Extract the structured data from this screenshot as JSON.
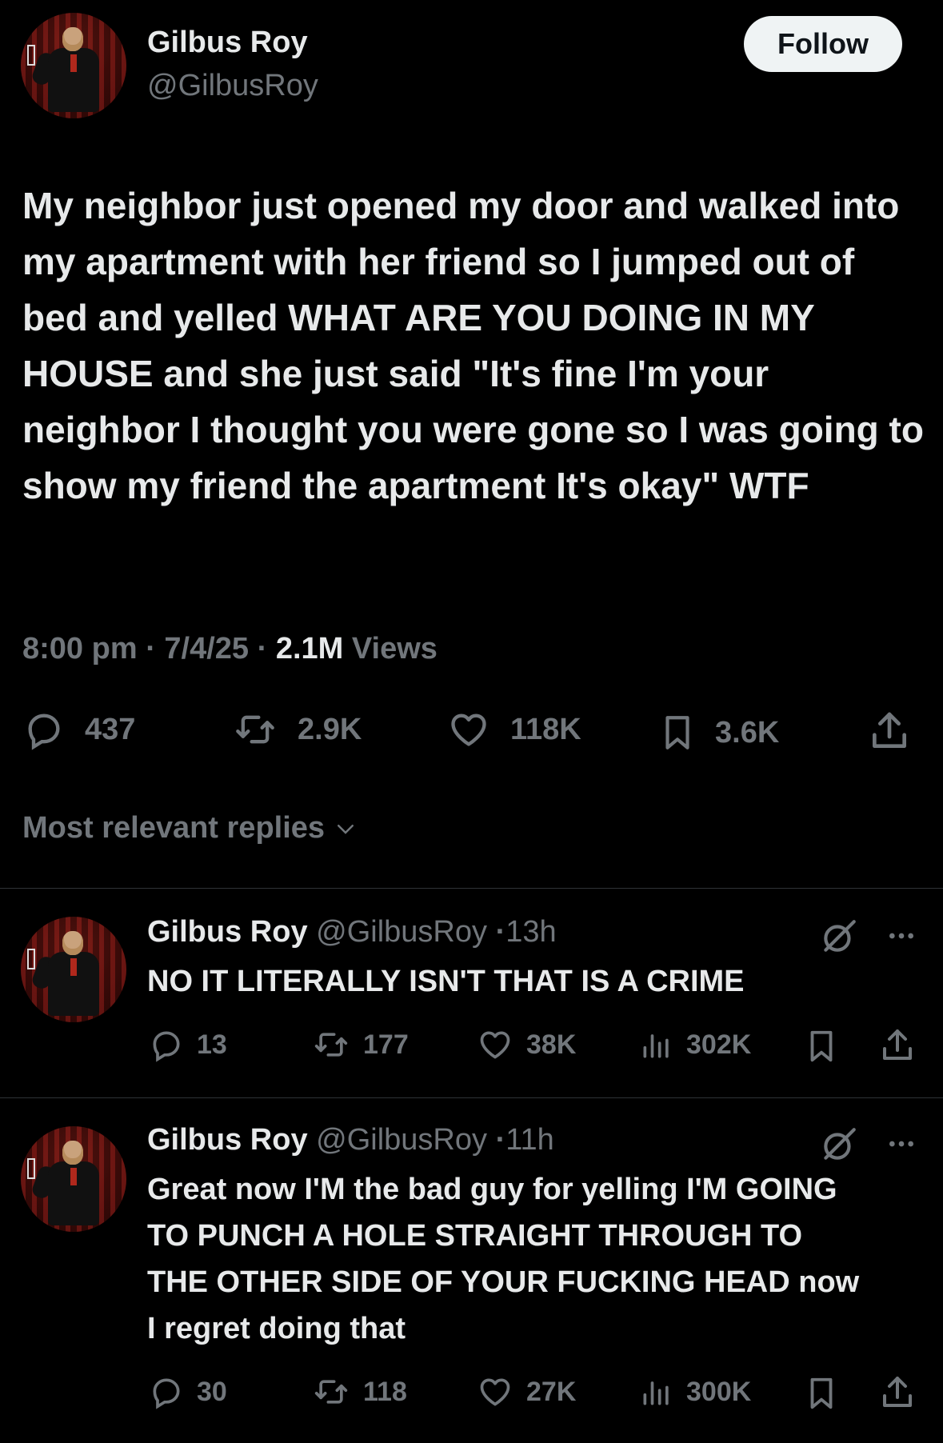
{
  "post": {
    "author_name": "Gilbus Roy",
    "author_handle": "@GilbusRoy",
    "follow_label": "Follow",
    "text": "My neighbor just opened my door and walked into my apartment with her friend so I jumped out of bed and yelled WHAT ARE YOU DOING IN MY HOUSE and she just said \"It's fine I'm your neighbor I thought you were gone so I was going to show my friend the apartment It's okay\" WTF",
    "time": "8:00 pm",
    "date": "7/4/25",
    "views_count": "2.1M",
    "views_label": "Views",
    "stats": {
      "replies": "437",
      "reposts": "2.9K",
      "likes": "118K",
      "bookmarks": "3.6K"
    }
  },
  "replies_sort_label": "Most relevant replies",
  "replies": [
    {
      "author_name": "Gilbus Roy",
      "author_handle": "@GilbusRoy",
      "time": "13h",
      "text": "NO IT LITERALLY ISN'T THAT IS A CRIME",
      "stats": {
        "replies": "13",
        "reposts": "177",
        "likes": "38K",
        "views": "302K"
      }
    },
    {
      "author_name": "Gilbus Roy",
      "author_handle": "@GilbusRoy",
      "time": "11h",
      "text": "Great now I'M the bad guy for yelling I'M GOING TO PUNCH A HOLE STRAIGHT THROUGH TO THE OTHER SIDE OF YOUR FUCKING HEAD now I regret doing that",
      "stats": {
        "replies": "30",
        "reposts": "118",
        "likes": "27K",
        "views": "300K"
      }
    }
  ],
  "colors": {
    "background": "#000000",
    "text": "#e7e9ea",
    "secondary": "#71767b",
    "divider": "#2f3336",
    "button_bg": "#eff3f4"
  },
  "icons": [
    "reply-icon",
    "repost-icon",
    "like-icon",
    "bookmark-icon",
    "share-icon",
    "views-icon",
    "grok-icon",
    "more-icon",
    "chevron-down-icon"
  ]
}
